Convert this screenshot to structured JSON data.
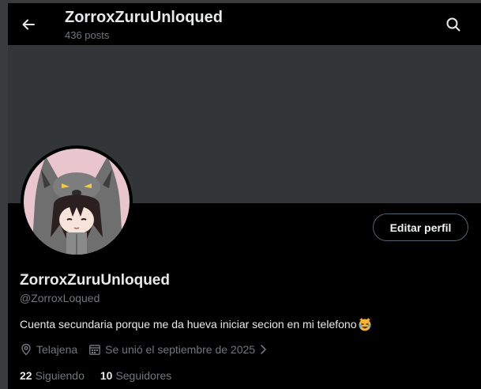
{
  "header": {
    "title": "ZorroxZuruUnloqued",
    "subtitle": "436 posts",
    "back_icon": "arrow-left-icon",
    "search_icon": "search-icon"
  },
  "profile": {
    "edit_button": "Editar perfil",
    "display_name": "ZorroxZuruUnloqued",
    "handle": "@ZorroxLoqued",
    "bio": "Cuenta secundaria porque me da hueva iniciar secion en mi telefono",
    "bio_emoji": "crying-laughing-cat-emoji",
    "location": "Telajena",
    "location_icon": "location-pin-icon",
    "joined": "Se unió el septiembre de 2025",
    "joined_icon": "calendar-icon",
    "following_count": "22",
    "following_label": "Siguiendo",
    "followers_count": "10",
    "followers_label": "Seguidores"
  },
  "colors": {
    "background": "#000000",
    "banner": "#333639",
    "primary_text": "#e7e9ea",
    "secondary_text": "#71767b",
    "button_border": "#536471"
  }
}
